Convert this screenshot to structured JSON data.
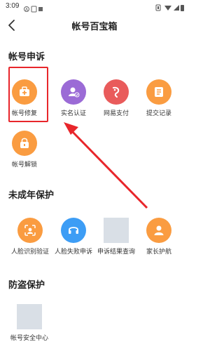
{
  "status_bar": {
    "time": "3:09"
  },
  "header": {
    "title": "帐号百宝箱"
  },
  "sections": [
    {
      "title": "帐号申诉",
      "items": [
        {
          "label": "帐号修复",
          "icon": "shield-repair-icon",
          "color": "#fa9c41"
        },
        {
          "label": "实名认证",
          "icon": "user-verified-icon",
          "color": "#9b6bd6"
        },
        {
          "label": "网易支付",
          "icon": "netease-pay-icon",
          "color": "#e95b5b"
        },
        {
          "label": "提交记录",
          "icon": "document-icon",
          "color": "#fa9c41"
        },
        {
          "label": "帐号解锁",
          "icon": "lock-icon",
          "color": "#fa9c41"
        }
      ]
    },
    {
      "title": "未成年保护",
      "items": [
        {
          "label": "人脸识别验证",
          "icon": "face-scan-icon",
          "color": "#fa9c41"
        },
        {
          "label": "人脸失败申诉",
          "icon": "headset-icon",
          "color": "#3d9df5"
        },
        {
          "label": "申诉结果查询",
          "icon": "placeholder-image",
          "color": "#d9dfe6"
        },
        {
          "label": "家长护航",
          "icon": "parent-user-icon",
          "color": "#fa9c41"
        }
      ]
    },
    {
      "title": "防盗保护",
      "items": [
        {
          "label": "帐号安全中心",
          "icon": "placeholder-image",
          "color": "#d9dfe6"
        }
      ]
    }
  ],
  "annotation_color": "#e8262b"
}
